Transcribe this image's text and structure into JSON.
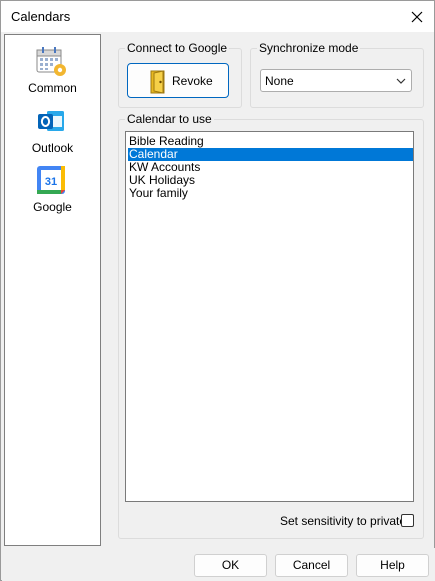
{
  "window": {
    "title": "Calendars"
  },
  "sidebar": {
    "items": [
      {
        "label": "Common",
        "icon": "calendar-gear-icon"
      },
      {
        "label": "Outlook",
        "icon": "outlook-icon"
      },
      {
        "label": "Google",
        "icon": "google-calendar-icon",
        "badge": "31"
      }
    ]
  },
  "connect": {
    "label": "Connect to Google",
    "button": "Revoke"
  },
  "sync": {
    "label": "Synchronize mode",
    "selected": "None"
  },
  "calendar": {
    "label": "Calendar to use",
    "items": [
      "Bible Reading",
      "Calendar",
      "KW Accounts",
      "UK Holidays",
      "Your family"
    ],
    "selected_index": 1
  },
  "privacy": {
    "label": "Set sensitivity to private",
    "checked": false
  },
  "footer": {
    "ok": "OK",
    "cancel": "Cancel",
    "help": "Help"
  },
  "colors": {
    "accent": "#0078d7",
    "outlook_blue": "#0364b8",
    "google_blue": "#1a73e8"
  }
}
